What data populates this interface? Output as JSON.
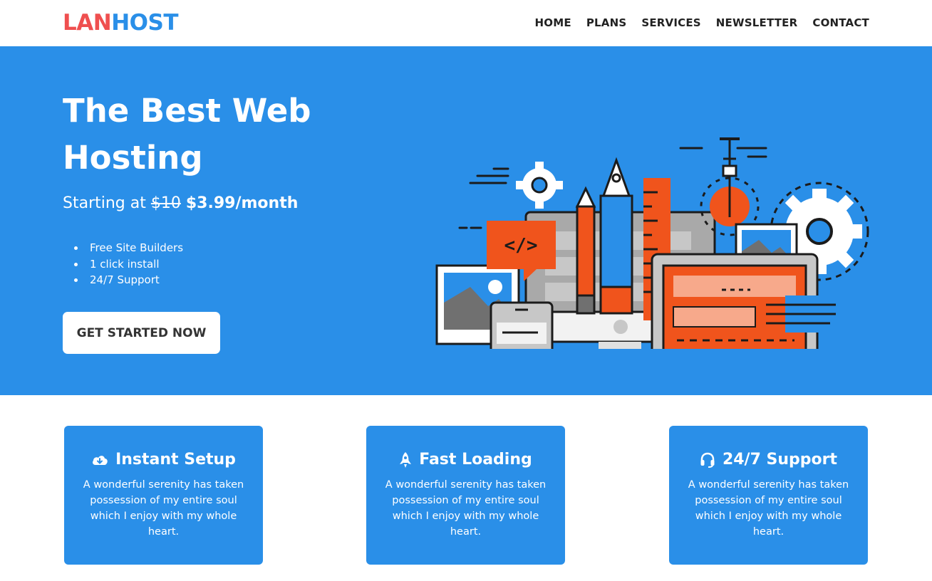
{
  "brand": {
    "part1": "LAN",
    "part2": "HOST",
    "color1": "#ef4f4f",
    "color2": "#2a8fe8"
  },
  "nav": {
    "items": [
      "HOME",
      "PLANS",
      "SERVICES",
      "NEWSLETTER",
      "CONTACT"
    ]
  },
  "hero": {
    "title": "The Best Web Hosting",
    "price_prefix": "Starting at",
    "price_old": "$10",
    "price_new": "$3.99/month",
    "features": [
      "Free Site Builders",
      "1 click install",
      "24/7 Support"
    ],
    "cta_label": "GET STARTED NOW",
    "background": "#2a8fe8",
    "illustration_icon": "web-devices-illustration"
  },
  "cards": [
    {
      "icon": "cloud-download-icon",
      "title": "Instant Setup",
      "text": "A wonderful serenity has taken possession of my entire soul which I enjoy with my whole heart."
    },
    {
      "icon": "rocket-icon",
      "title": "Fast Loading",
      "text": "A wonderful serenity has taken possession of my entire soul which I enjoy with my whole heart."
    },
    {
      "icon": "headset-icon",
      "title": "24/7 Support",
      "text": "A wonderful serenity has taken possession of my entire soul which I enjoy with my whole heart."
    }
  ]
}
